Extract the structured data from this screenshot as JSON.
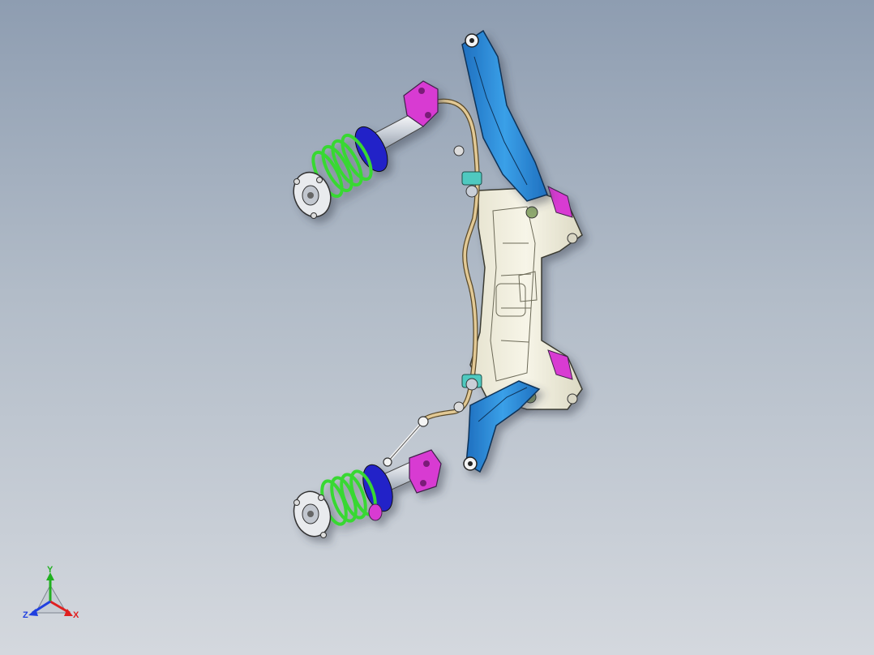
{
  "viewport": {
    "background_top": "#8e9db1",
    "background_bottom": "#d4d8de"
  },
  "model": {
    "parts": [
      {
        "name": "front-subframe",
        "color": "#f2f0de"
      },
      {
        "name": "left-control-arm",
        "color": "#2f86d2"
      },
      {
        "name": "right-control-arm",
        "color": "#2f86d2"
      },
      {
        "name": "stabilizer-bar",
        "color": "#d9bf8a"
      },
      {
        "name": "strut-upper",
        "color": "#d8dde6"
      },
      {
        "name": "strut-lower",
        "color": "#d8dde6"
      },
      {
        "name": "coil-spring",
        "color": "#39d832"
      },
      {
        "name": "knuckle-bracket",
        "color": "#d83ad2"
      },
      {
        "name": "spring-seat",
        "color": "#2222c8"
      }
    ]
  },
  "triad": {
    "x_label": "X",
    "y_label": "Y",
    "z_label": "Z",
    "x_color": "#e02020",
    "y_color": "#20b020",
    "z_color": "#2040e0",
    "icon": "coordinate-triad-icon"
  }
}
